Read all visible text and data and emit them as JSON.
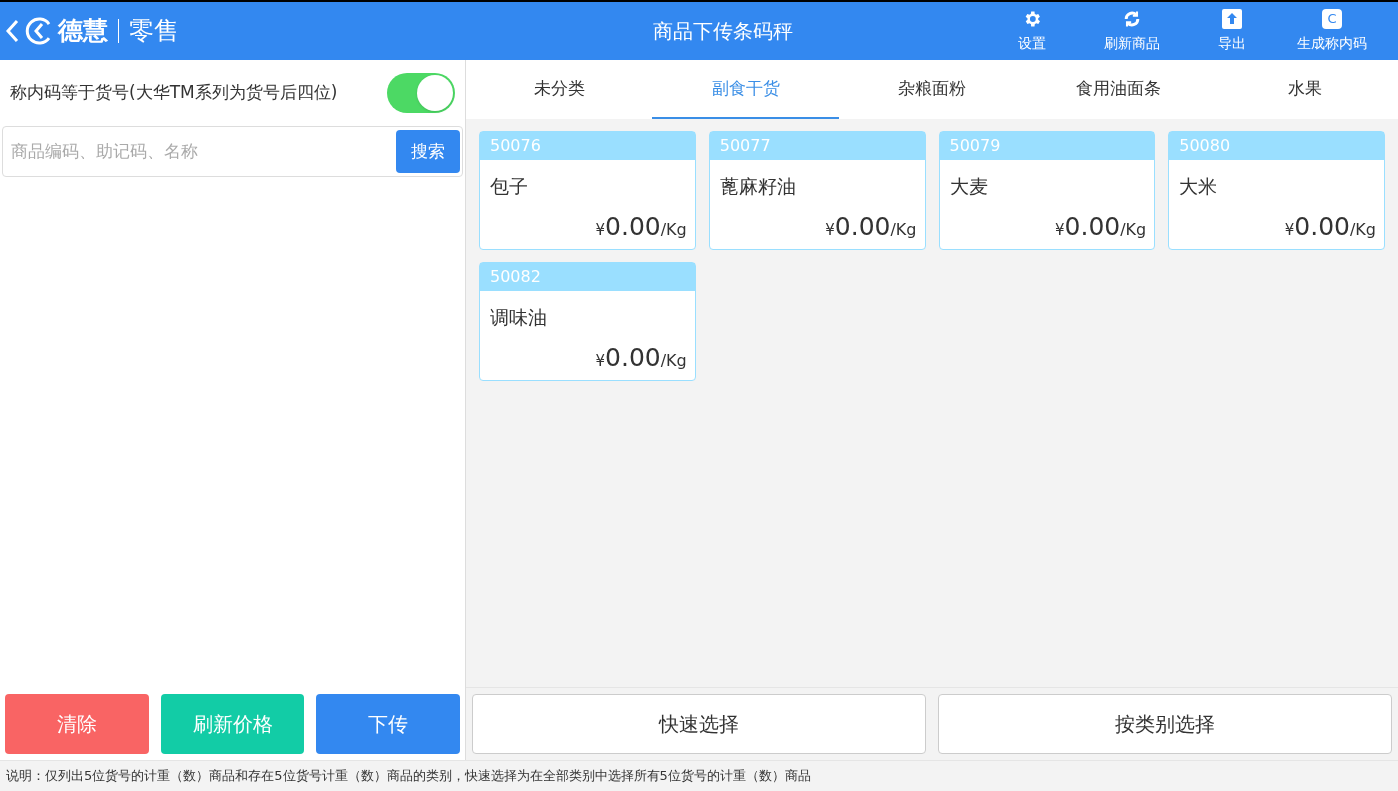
{
  "header": {
    "brand": "德慧",
    "product": "零售",
    "title": "商品下传条码秤",
    "actions": [
      {
        "kind": "gear",
        "label": "设置"
      },
      {
        "kind": "refresh",
        "label": "刷新商品"
      },
      {
        "kind": "upload",
        "label": "导出"
      },
      {
        "kind": "letter",
        "glyph": "C",
        "label": "生成称内码"
      }
    ]
  },
  "option": {
    "label": "称内码等于货号(大华TM系列为货号后四位)",
    "on": true
  },
  "search": {
    "placeholder": "商品编码、助记码、名称",
    "button": "搜索"
  },
  "left_buttons": [
    {
      "label": "清除",
      "color": "#f96464"
    },
    {
      "label": "刷新价格",
      "color": "#12cca6"
    },
    {
      "label": "下传",
      "color": "#3388f0"
    }
  ],
  "tabs": [
    {
      "label": "未分类",
      "selected": false
    },
    {
      "label": "副食干货",
      "selected": true
    },
    {
      "label": "杂粮面粉",
      "selected": false
    },
    {
      "label": "食用油面条",
      "selected": false
    },
    {
      "label": "水果",
      "selected": false
    }
  ],
  "products": [
    {
      "code": "50076",
      "name": "包子",
      "currency": "¥",
      "price": "0.00",
      "unit": "/Kg"
    },
    {
      "code": "50077",
      "name": "蓖麻籽油",
      "currency": "¥",
      "price": "0.00",
      "unit": "/Kg"
    },
    {
      "code": "50079",
      "name": "大麦",
      "currency": "¥",
      "price": "0.00",
      "unit": "/Kg"
    },
    {
      "code": "50080",
      "name": "大米",
      "currency": "¥",
      "price": "0.00",
      "unit": "/Kg"
    },
    {
      "code": "50082",
      "name": "调味油",
      "currency": "¥",
      "price": "0.00",
      "unit": "/Kg"
    }
  ],
  "right_buttons": [
    "快速选择",
    "按类别选择"
  ],
  "note": "说明：仅列出5位货号的计重（数）商品和存在5位货号计重（数）商品的类别，快速选择为在全部类别中选择所有5位货号的计重（数）商品"
}
